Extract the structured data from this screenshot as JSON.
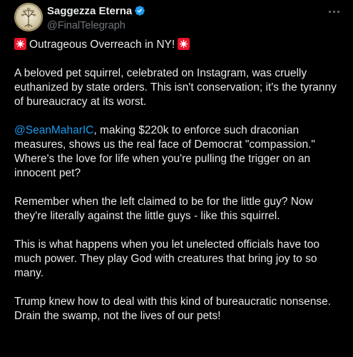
{
  "author": {
    "display_name": "Saggezza Eterna",
    "handle": "@FinalTelegraph",
    "verified": true,
    "avatar_icon": "tree-of-life-logo"
  },
  "colors": {
    "background": "#000000",
    "text": "#e7e9ea",
    "secondary": "#71767b",
    "link": "#1d9bf0",
    "siren": "#e8132a"
  },
  "tweet": {
    "headline": "Outrageous Overreach in NY!",
    "p1": "A beloved pet squirrel, celebrated on Instagram, was cruelly euthanized by state orders. This isn't conservation; it's the tyranny of bureaucracy at its worst.",
    "p2_mention": "@SeanMaharIC",
    "p2_text": ", making $220k to enforce such draconian measures, shows us the real face of Democrat \"compassion.\" Where's the love for life when you're pulling the trigger on an innocent pet?",
    "p3": "Remember when the left claimed to be for the little guy? Now they're literally against the little guys - like this squirrel.",
    "p4": "This is what happens when you let unelected officials have too much power. They play God with creatures that bring joy to so many.",
    "p5": "Trump knew how to deal with this kind of bureaucratic nonsense. Drain the swamp, not the lives of our pets!"
  }
}
